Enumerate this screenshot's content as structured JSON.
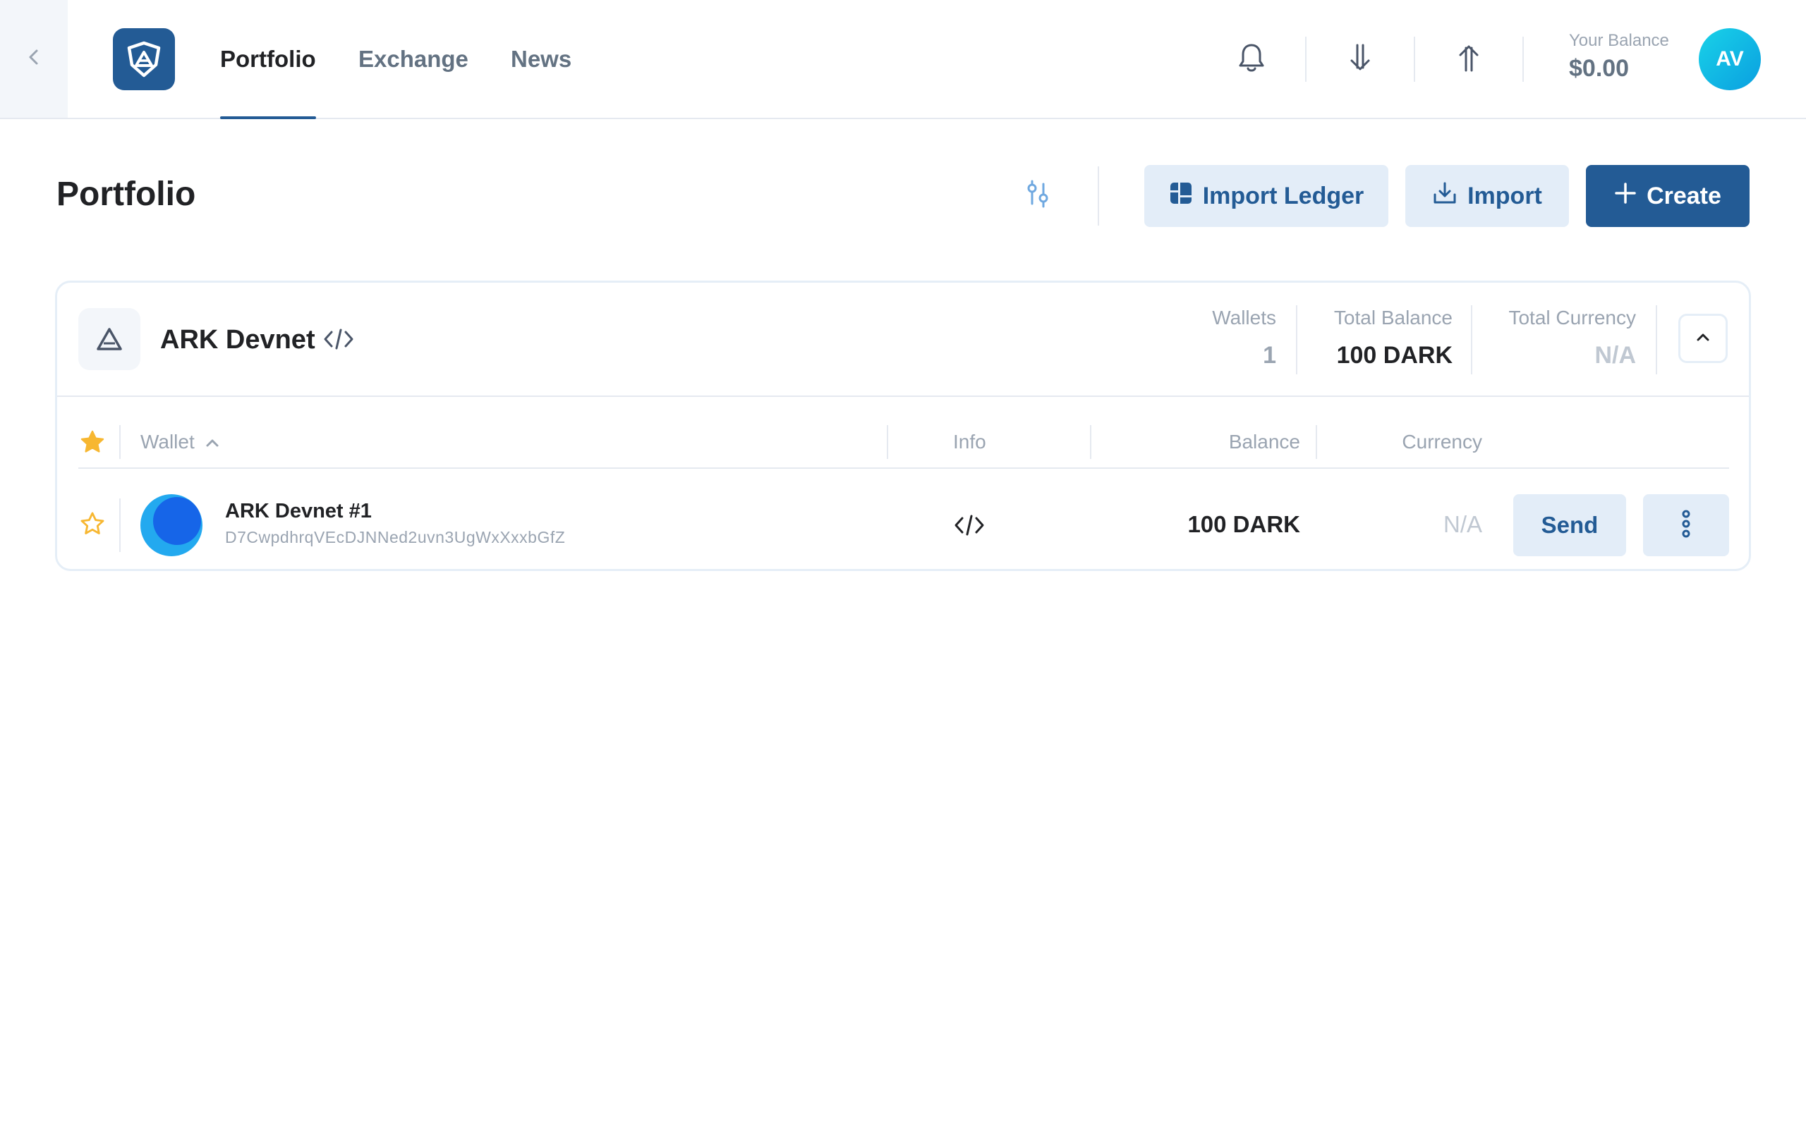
{
  "nav": {
    "tabs": [
      {
        "label": "Portfolio",
        "active": true
      },
      {
        "label": "Exchange",
        "active": false
      },
      {
        "label": "News",
        "active": false
      }
    ],
    "icons": [
      "back-chevron-icon",
      "bell-icon",
      "receive-arrow-icon",
      "send-arrow-icon"
    ],
    "balance_label": "Your Balance",
    "balance_value": "$0.00",
    "avatar_initials": "AV"
  },
  "page": {
    "title": "Portfolio",
    "buttons": {
      "import_ledger": "Import Ledger",
      "import": "Import",
      "create": "Create"
    }
  },
  "network": {
    "name": "ARK Devnet",
    "stats": {
      "wallets_label": "Wallets",
      "wallets_value": "1",
      "total_balance_label": "Total Balance",
      "total_balance_value": "100 DARK",
      "total_currency_label": "Total Currency",
      "total_currency_value": "N/A"
    },
    "table": {
      "headers": {
        "wallet": "Wallet",
        "info": "Info",
        "balance": "Balance",
        "currency": "Currency"
      },
      "rows": [
        {
          "name": "ARK Devnet #1",
          "address": "D7CwpdhrqVEcDJNNed2uvn3UgWxXxxbGfZ",
          "balance": "100 DARK",
          "currency": "N/A",
          "starred": false,
          "send_label": "Send"
        }
      ]
    }
  },
  "colors": {
    "primary": "#235b95",
    "primary_light": "#e3edf8",
    "star": "#f7b731",
    "text_muted": "#9aa4b1"
  }
}
